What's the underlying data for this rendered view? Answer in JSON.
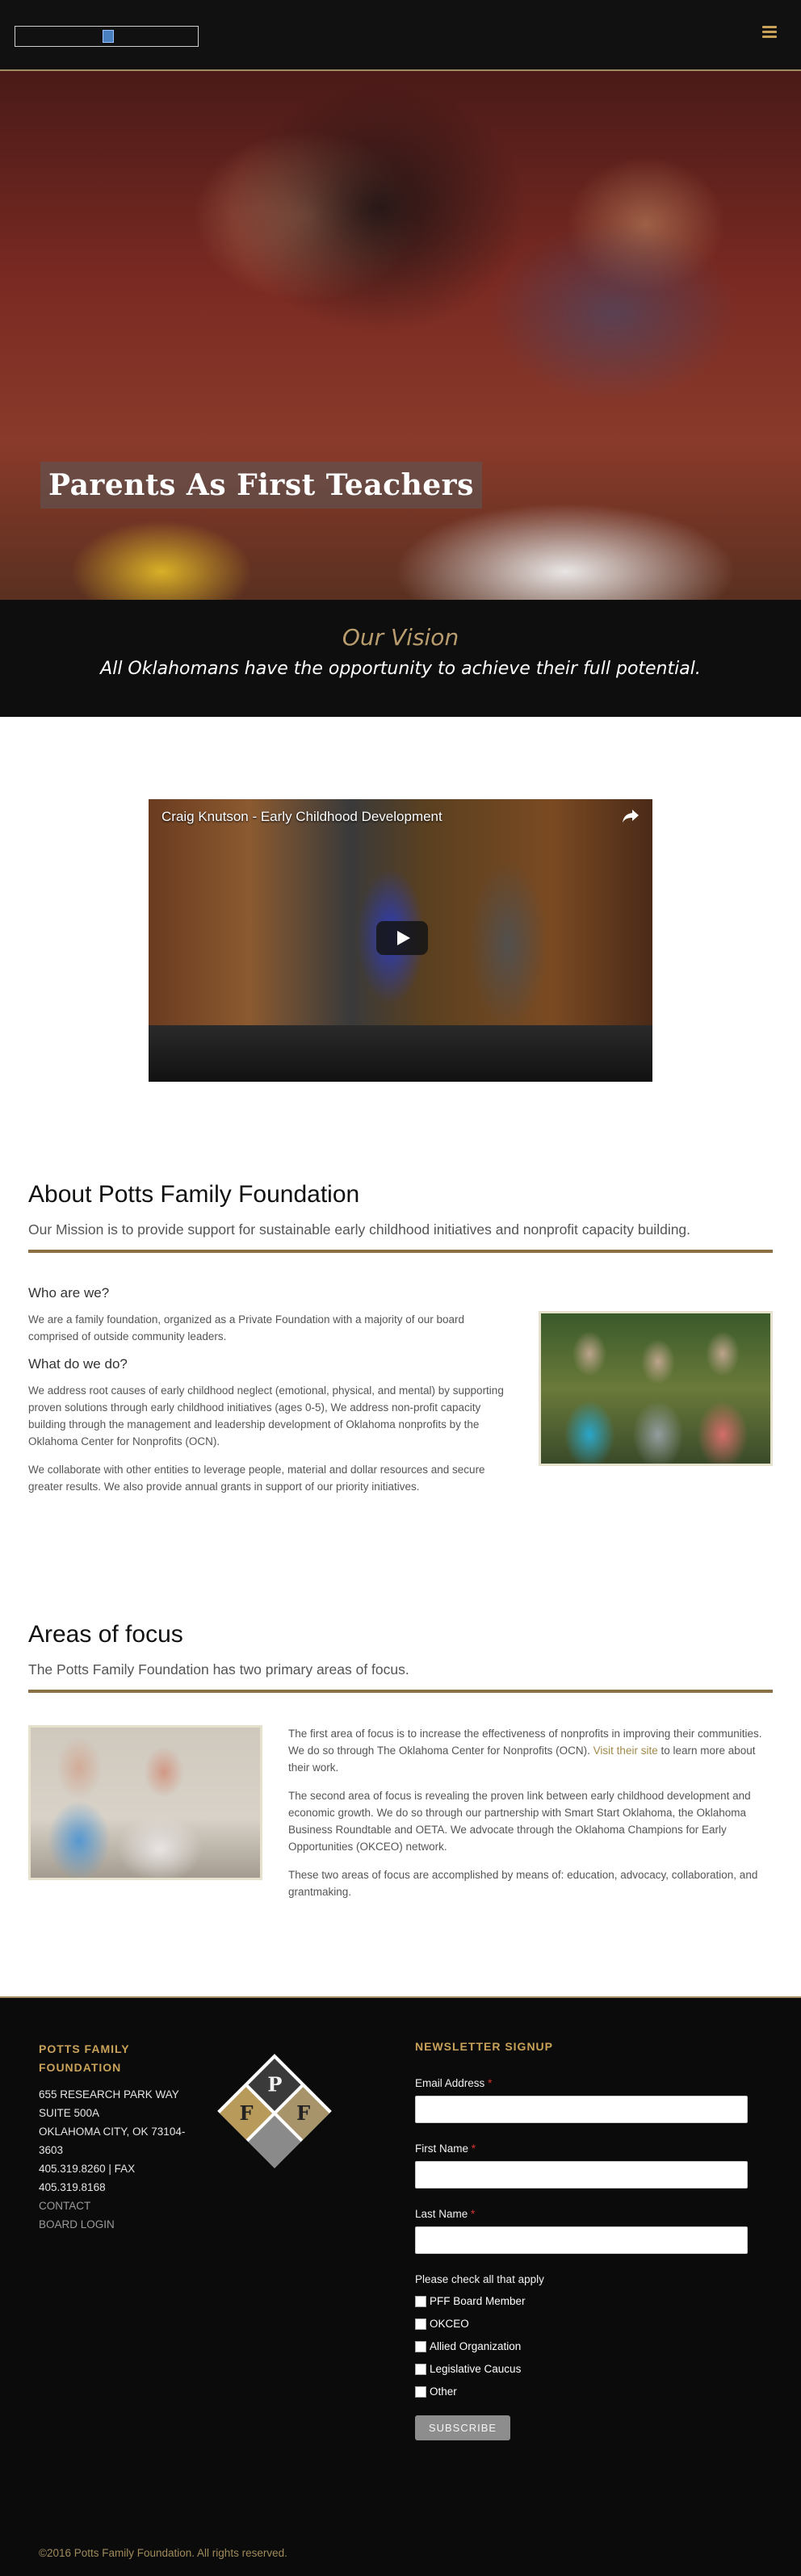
{
  "header": {
    "menu_icon": "hamburger-menu-icon",
    "logo_icon": "broken-image-icon"
  },
  "hero": {
    "title": "Parents As First Teachers"
  },
  "vision": {
    "heading": "Our Vision",
    "statement": "All Oklahomans have the opportunity to achieve their full potential."
  },
  "video": {
    "title": "Craig Knutson - Early Childhood Development",
    "share_icon": "share-icon",
    "play_icon": "play-icon"
  },
  "about": {
    "title": "About Potts Family Foundation",
    "mission": "Our Mission is to provide support for sustainable early childhood initiatives and nonprofit capacity building.",
    "who_heading": "Who are we?",
    "who_text": "We are a family foundation, organized as a Private Foundation with a majority of our board comprised of outside community leaders.",
    "what_heading": "What do we do?",
    "what_text": "We address root causes of early childhood neglect (emotional, physical, and mental) by supporting proven solutions through early childhood initiatives (ages 0-5), We address non-profit capacity building through the management and leadership development of Oklahoma nonprofits by the Oklahoma Center for Nonprofits (OCN).",
    "collab_text": "We collaborate with other entities to leverage people, material and dollar resources and secure greater results. We also provide annual grants in support of our priority initiatives."
  },
  "focus": {
    "title": "Areas of focus",
    "subtitle": "The Potts Family Foundation has two primary areas of focus.",
    "p1_before": "The first area of focus is to increase the effectiveness of nonprofits in improving their communities. We do so through The Oklahoma Center for Nonprofits (OCN). ",
    "p1_link": "Visit their site",
    "p1_after": " to learn more about their work.",
    "p2": "The second area of focus is revealing the proven link between early childhood development and economic growth. We do so through our partnership with Smart Start Oklahoma, the Oklahoma Business Roundtable and OETA. We advocate through the Oklahoma Champions for Early Opportunities (OKCEO) network.",
    "p3": "These two areas of focus are accomplished by means of: education, advocacy, collaboration, and grantmaking."
  },
  "footer": {
    "brand_title": "POTTS FAMILY FOUNDATION",
    "address1": "655 RESEARCH PARK WAY",
    "address2": "SUITE 500A",
    "address3": "OKLAHOMA CITY, OK 73104-3603",
    "phone": "405.319.8260 | FAX",
    "fax": "405.319.8168",
    "contact": "CONTACT",
    "board_login": "BOARD LOGIN",
    "logo_letters": {
      "top": "P",
      "left": "F",
      "right": "F"
    },
    "newsletter_title": "NEWSLETTER SIGNUP",
    "email_label": "Email Address",
    "first_name_label": "First Name",
    "last_name_label": "Last Name",
    "required_mark": "*",
    "check_title": "Please check all that apply",
    "checkboxes": [
      "PFF Board Member",
      "OKCEO",
      "Allied Organization",
      "Legislative Caucus",
      "Other"
    ],
    "subscribe_label": "SUBSCRIBE",
    "copyright": "©2016 Potts Family Foundation. All rights reserved."
  }
}
